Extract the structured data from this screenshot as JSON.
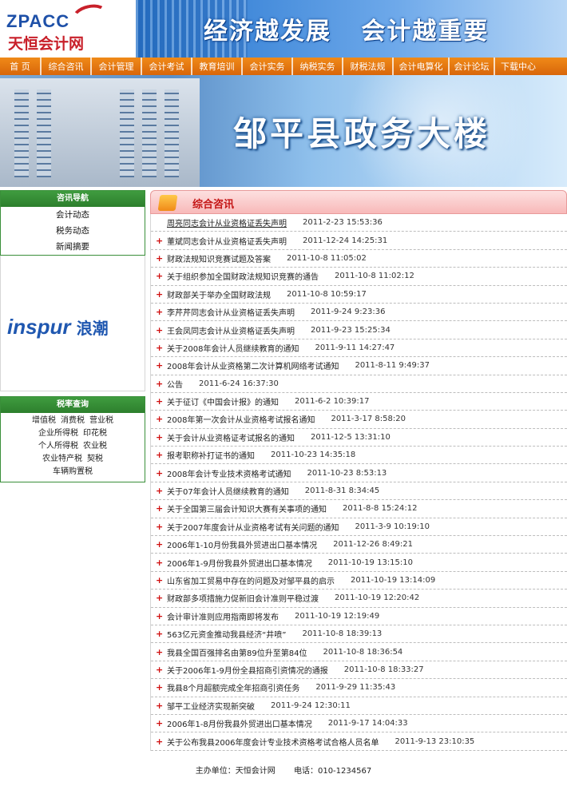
{
  "header": {
    "logo_en": "ZPACC",
    "logo_cn": "天恒会计网",
    "slogan": "经济越发展   会计越重要"
  },
  "nav": [
    {
      "label": "首 页"
    },
    {
      "label": "综合咨讯"
    },
    {
      "label": "会计管理"
    },
    {
      "label": "会计考试"
    },
    {
      "label": "教育培训"
    },
    {
      "label": "会计实务"
    },
    {
      "label": "纳税实务"
    },
    {
      "label": "财税法规"
    },
    {
      "label": "会计电算化"
    },
    {
      "label": "会计论坛"
    },
    {
      "label": "下载中心"
    }
  ],
  "banner": {
    "title": "邹平县政务大楼"
  },
  "sidebar": {
    "guide_title": "咨讯导航",
    "guide_items": [
      {
        "label": "会计动态"
      },
      {
        "label": "税务动态"
      },
      {
        "label": "新闻摘要"
      }
    ],
    "sponsor_en": "inspur",
    "sponsor_cn": "浪潮",
    "tax_title": "税率查询",
    "tax_rows": [
      [
        "增值税",
        "消费税",
        "营业税"
      ],
      [
        "企业所得税",
        "印花税"
      ],
      [
        "个人所得税",
        "农业税"
      ],
      [
        "农业特产税",
        "契税"
      ],
      [
        "车辆购置税"
      ]
    ]
  },
  "main": {
    "section_title": "综合咨讯",
    "news": [
      {
        "title": "周亮同志会计从业资格证丢失声明",
        "date": "2011-2-23 15:53:36"
      },
      {
        "title": "董斌同志会计从业资格证丢失声明",
        "date": "2011-12-24 14:25:31"
      },
      {
        "title": "财政法规知识竞赛试题及答案",
        "date": "2011-10-8 11:05:02"
      },
      {
        "title": "关于组织参加全国财政法规知识竞赛的通告",
        "date": "2011-10-8 11:02:12"
      },
      {
        "title": "财政部关于举办全国财政法规",
        "date": "2011-10-8 10:59:17"
      },
      {
        "title": "李芹芹同志会计从业资格证丢失声明",
        "date": "2011-9-24 9:23:36"
      },
      {
        "title": "王会凤同志会计从业资格证丢失声明",
        "date": "2011-9-23 15:25:34"
      },
      {
        "title": "关于2008年会计人员继续教育的通知",
        "date": "2011-9-11 14:27:47"
      },
      {
        "title": "2008年会计从业资格第二次计算机网络考试通知",
        "date": "2011-8-11 9:49:37"
      },
      {
        "title": "公告",
        "date": "2011-6-24 16:37:30"
      },
      {
        "title": "关于征订《中国会计报》的通知",
        "date": "2011-6-2 10:39:17"
      },
      {
        "title": "2008年第一次会计从业资格考试报名通知",
        "date": "2011-3-17 8:58:20"
      },
      {
        "title": "关于会计从业资格证考试报名的通知",
        "date": "2011-12-5 13:31:10"
      },
      {
        "title": "报考职称补打证书的通知",
        "date": "2011-10-23 14:35:18"
      },
      {
        "title": "2008年会计专业技术资格考试通知",
        "date": "2011-10-23 8:53:13"
      },
      {
        "title": "关于07年会计人员继续教育的通知",
        "date": "2011-8-31 8:34:45"
      },
      {
        "title": "关于全国第三届会计知识大赛有关事项的通知",
        "date": "2011-8-8 15:24:12"
      },
      {
        "title": "关于2007年度会计从业资格考试有关问题的通知",
        "date": "2011-3-9 10:19:10"
      },
      {
        "title": "2006年1-10月份我县外贸进出口基本情况",
        "date": "2011-12-26 8:49:21"
      },
      {
        "title": "2006年1-9月份我县外贸进出口基本情况",
        "date": "2011-10-19 13:15:10"
      },
      {
        "title": "山东省加工贸易中存在的问题及对邹平县的启示",
        "date": "2011-10-19 13:14:09"
      },
      {
        "title": "财政部多项措施力促新旧会计准则平稳过渡",
        "date": "2011-10-19 12:20:42"
      },
      {
        "title": "会计审计准则应用指南即将发布",
        "date": "2011-10-19 12:19:49"
      },
      {
        "title": "563亿元资金推动我县经济“井喷”",
        "date": "2011-10-8 18:39:13"
      },
      {
        "title": "我县全国百强排名由第89位升至第84位",
        "date": "2011-10-8 18:36:54"
      },
      {
        "title": "关于2006年1-9月份全县招商引资情况的通报",
        "date": "2011-10-8 18:33:27"
      },
      {
        "title": "我县8个月超额完成全年招商引资任务",
        "date": "2011-9-29 11:35:43"
      },
      {
        "title": "邹平工业经济实现新突破",
        "date": "2011-9-24 12:30:11"
      },
      {
        "title": "2006年1-8月份我县外贸进出口基本情况",
        "date": "2011-9-17 14:04:33"
      },
      {
        "title": "关于公布我县2006年度会计专业技术资格考试合格人员名单",
        "date": "2011-9-13 23:10:35"
      }
    ]
  },
  "footer": {
    "sponsor": "主办单位：天恒会计网",
    "phone": "电话：010-1234567"
  }
}
